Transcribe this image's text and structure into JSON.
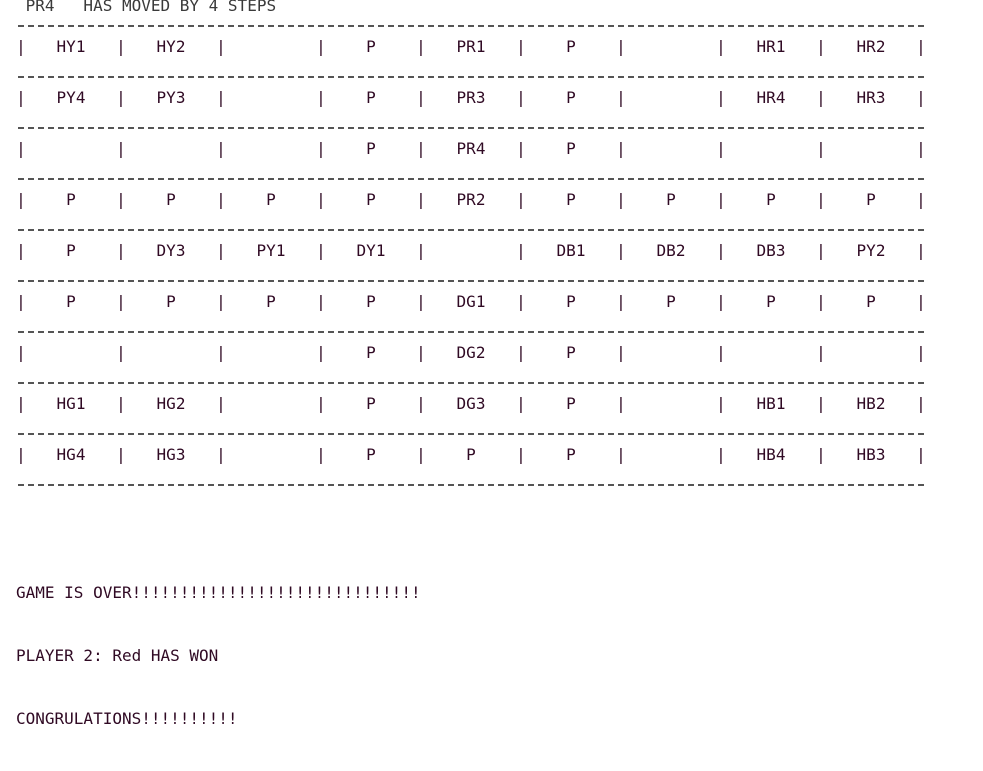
{
  "terminal": {
    "status_line": " PR4   HAS MOVED BY 4 STEPS",
    "board": {
      "rows": [
        [
          "HY1",
          "HY2",
          "",
          "P",
          "PR1",
          "P",
          "",
          "HR1",
          "HR2"
        ],
        [
          "PY4",
          "PY3",
          "",
          "P",
          "PR3",
          "P",
          "",
          "HR4",
          "HR3"
        ],
        [
          "",
          "",
          "",
          "P",
          "PR4",
          "P",
          "",
          "",
          ""
        ],
        [
          "P",
          "P",
          "P",
          "P",
          "PR2",
          "P",
          "P",
          "P",
          "P"
        ],
        [
          "P",
          "DY3",
          "PY1",
          "DY1",
          "",
          "DB1",
          "DB2",
          "DB3",
          "PY2"
        ],
        [
          "P",
          "P",
          "P",
          "P",
          "DG1",
          "P",
          "P",
          "P",
          "P"
        ],
        [
          "",
          "",
          "",
          "P",
          "DG2",
          "P",
          "",
          "",
          ""
        ],
        [
          "HG1",
          "HG2",
          "",
          "P",
          "DG3",
          "P",
          "",
          "HB1",
          "HB2"
        ],
        [
          "HG4",
          "HG3",
          "",
          "P",
          "P",
          "P",
          "",
          "HB4",
          "HB3"
        ]
      ]
    },
    "messages": [
      "GAME IS OVER!!!!!!!!!!!!!!!!!!!!!!!!!!!!!!",
      "PLAYER 2: Red HAS WON",
      "CONGRULATIONS!!!!!!!!!!"
    ]
  }
}
